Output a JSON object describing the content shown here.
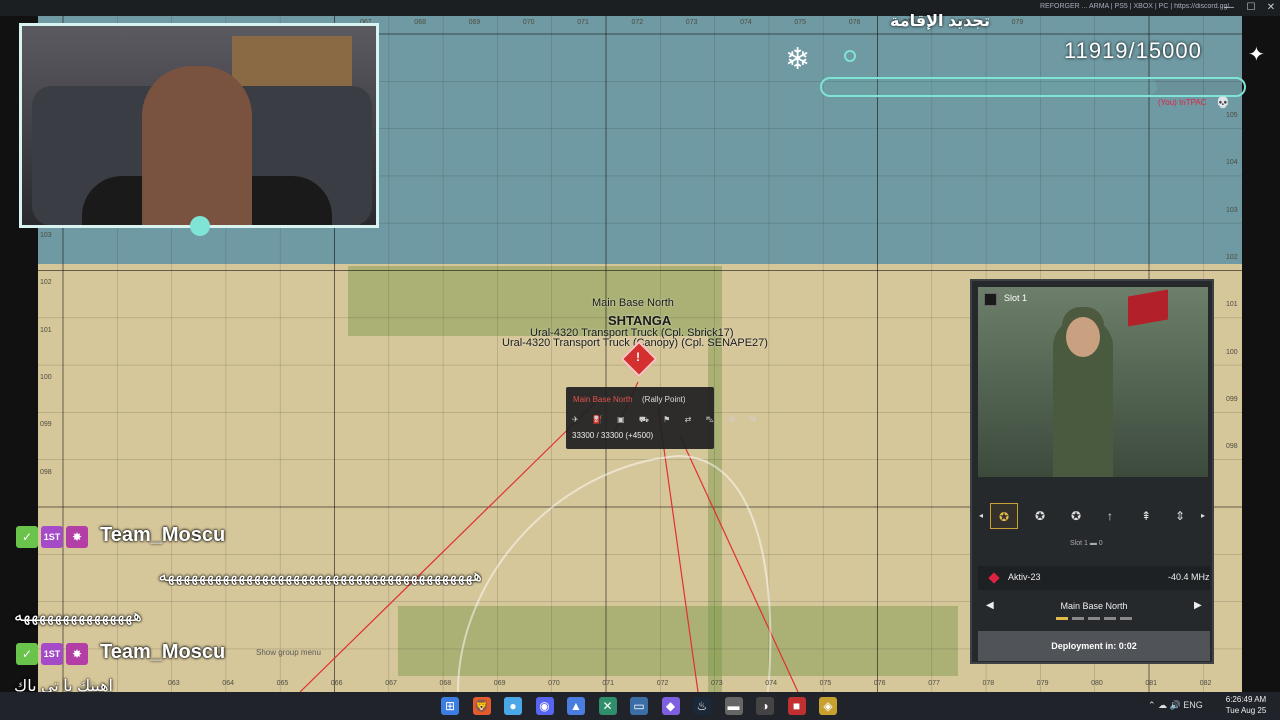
{
  "window": {
    "title": "REFORGER ... ARMA | PS5 | XBOX | PC | https://discord.gg/A-N | 1.5.0.10 (Steam)",
    "minimize": "—",
    "maximize": "☐",
    "close": "✕"
  },
  "map": {
    "base_name": "Main Base North",
    "town_name": "SHTANGA",
    "vehicle_1": "Ural-4320 Transport Truck (Cpl. Sbrick17)",
    "vehicle_2": "Ural-4320 Transport Truck (Canopy) (Cpl. SENAPE27)",
    "top_coords": [
      "067",
      "068",
      "069",
      "070",
      "071",
      "072",
      "073",
      "074",
      "075",
      "076",
      "077",
      "078",
      "079"
    ],
    "bottom_coords": [
      "063",
      "064",
      "065",
      "066",
      "067",
      "068",
      "069",
      "070",
      "071",
      "072",
      "073",
      "074",
      "075",
      "076",
      "077",
      "078",
      "079",
      "080",
      "081",
      "082",
      "083",
      "084"
    ],
    "left_coords": [
      "103",
      "102",
      "101",
      "100",
      "099",
      "098"
    ],
    "right_coords": [
      "105",
      "104",
      "103",
      "102",
      "101",
      "100",
      "099",
      "098"
    ]
  },
  "rally": {
    "name": "Main Base North",
    "type": "(Rally Point)",
    "icons": "✈ ⛽ ▣ ⛟ ⚑ ⇄ ⛍ ⚙ ⚒",
    "supply": "33300 / 33300 (+4500)"
  },
  "goal": {
    "title": "تجديد الإقامة",
    "progress_text": "11919/15000",
    "current": 11919,
    "target": 15000,
    "accent": "#7fe3d6"
  },
  "kill_feed": {
    "tag": "(You) InTPAC",
    "skull": "💀"
  },
  "panel": {
    "slot_title": "Slot 1",
    "slot_icons": [
      "✪",
      "✪",
      "✪",
      "↑",
      "⇞",
      "⇕"
    ],
    "slot_info": "Slot 1   ▬ 0",
    "radio_name": "Aktiv-23",
    "radio_freq": "-40.4 MHz",
    "spawn_name": "Main Base North",
    "spawn_prev": "◀",
    "spawn_next": "▶",
    "deploy": "Deployment in: 0:02"
  },
  "chat": [
    {
      "user": "Team_Moscu",
      "text": "ههههههههههههههههههههههههههههههههههههههههه"
    },
    {
      "user": "",
      "text": "هههههههههههههههه"
    },
    {
      "user": "Team_Moscu",
      "text": "اهينك يا تي باك"
    }
  ],
  "chat_badges": [
    "✓",
    "1ST",
    "✸"
  ],
  "show_group_menu": "Show group menu",
  "taskbar": {
    "icons": [
      "⊞",
      "🦁",
      "●",
      "◉",
      "▲",
      "✕",
      "▭",
      "◆",
      "♨",
      "▬",
      "◑",
      "■",
      "◈"
    ],
    "tray": "⌃  ☁  🔊  ENG",
    "time": "6:26:49 AM",
    "date": "Tue Aug 25"
  }
}
